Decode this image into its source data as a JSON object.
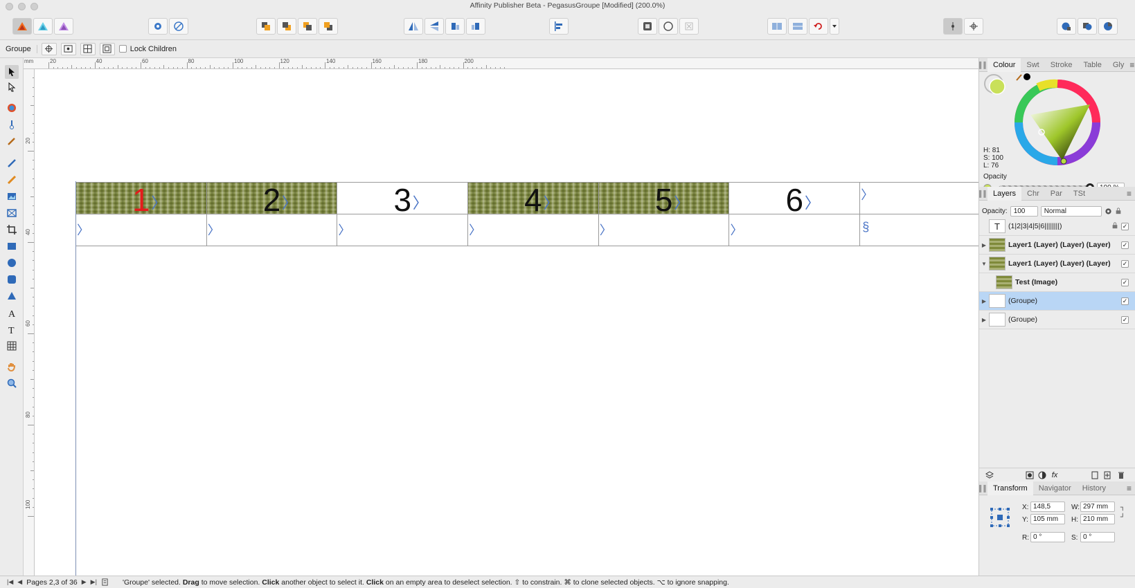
{
  "window": {
    "title": "Affinity Publisher Beta - PegasusGroupe [Modified] (200.0%)"
  },
  "context_bar": {
    "selection_label": "Groupe",
    "lock_children_label": "Lock Children"
  },
  "ruler": {
    "unit": "mm",
    "top_labels": [
      "20",
      "40",
      "60",
      "80",
      "100",
      "120",
      "140",
      "160",
      "180",
      "200"
    ],
    "left_labels": [
      "20",
      "40",
      "60",
      "80",
      "100"
    ]
  },
  "table": {
    "header_cells": [
      {
        "number": "1",
        "highlight": true,
        "textured": true
      },
      {
        "number": "2",
        "highlight": false,
        "textured": true
      },
      {
        "number": "3",
        "highlight": false,
        "textured": false
      },
      {
        "number": "4",
        "highlight": false,
        "textured": true
      },
      {
        "number": "5",
        "highlight": false,
        "textured": true
      },
      {
        "number": "6",
        "highlight": false,
        "textured": false
      }
    ],
    "text_flow_mark": "〉",
    "section_mark": "§"
  },
  "colour_panel": {
    "tabs": [
      "Colour",
      "Swt",
      "Stroke",
      "Table",
      "Gly"
    ],
    "active_tab": "Colour",
    "h": "H: 81",
    "s": "S: 100",
    "l": "L: 76",
    "opacity_label": "Opacity",
    "opacity_value": "100 %",
    "fill_color": "#c9e05a"
  },
  "layers_panel": {
    "tabs": [
      "Layers",
      "Chr",
      "Par",
      "TSt"
    ],
    "active_tab": "Layers",
    "opacity_label": "Opacity:",
    "opacity_value": "100",
    "blend_mode": "Normal",
    "rows": [
      {
        "name": "(1|2|3|4|5|6||||||||)",
        "thumb": "T",
        "expander": "",
        "locked": true,
        "selected": false,
        "bold": false,
        "indent": false
      },
      {
        "name": "Layer1 (Layer) (Layer) (Layer)",
        "thumb": "grass",
        "expander": "▶",
        "locked": false,
        "selected": false,
        "bold": true,
        "indent": false
      },
      {
        "name": "Layer1 (Layer) (Layer) (Layer)",
        "thumb": "grass",
        "expander": "▼",
        "locked": false,
        "selected": false,
        "bold": true,
        "indent": false
      },
      {
        "name": "Test (Image)",
        "thumb": "grass",
        "expander": "",
        "locked": false,
        "selected": false,
        "bold": true,
        "indent": true
      },
      {
        "name": "(Groupe)",
        "thumb": "blank",
        "expander": "▶",
        "locked": false,
        "selected": true,
        "bold": false,
        "indent": false
      },
      {
        "name": "(Groupe)",
        "thumb": "blank",
        "expander": "▶",
        "locked": false,
        "selected": false,
        "bold": false,
        "indent": false
      }
    ]
  },
  "transform_panel": {
    "tabs": [
      "Transform",
      "Navigator",
      "History"
    ],
    "active_tab": "Transform",
    "x_label": "X:",
    "x_value": "148,5",
    "y_label": "Y:",
    "y_value": "105 mm",
    "w_label": "W:",
    "w_value": "297 mm",
    "h_label": "H:",
    "h_value": "210 mm",
    "r_label": "R:",
    "r_value": "0 °",
    "s_label": "S:",
    "s_value": "0 °"
  },
  "status_bar": {
    "pages": "Pages 2,3 of 36",
    "message_parts": [
      {
        "text": "'Groupe' selected. ",
        "bold": false
      },
      {
        "text": "Drag",
        "bold": true
      },
      {
        "text": " to move selection. ",
        "bold": false
      },
      {
        "text": "Click",
        "bold": true
      },
      {
        "text": " another object to select it. ",
        "bold": false
      },
      {
        "text": "Click",
        "bold": true
      },
      {
        "text": " on an empty area to deselect selection. ⇧ to constrain. ⌘ to clone selected objects. ⌥ to ignore snapping.",
        "bold": false
      }
    ]
  },
  "colors": {
    "accent_blue": "#4a74c6",
    "selection_blue": "#b9d6f5",
    "highlight_red": "#e41c1c"
  }
}
